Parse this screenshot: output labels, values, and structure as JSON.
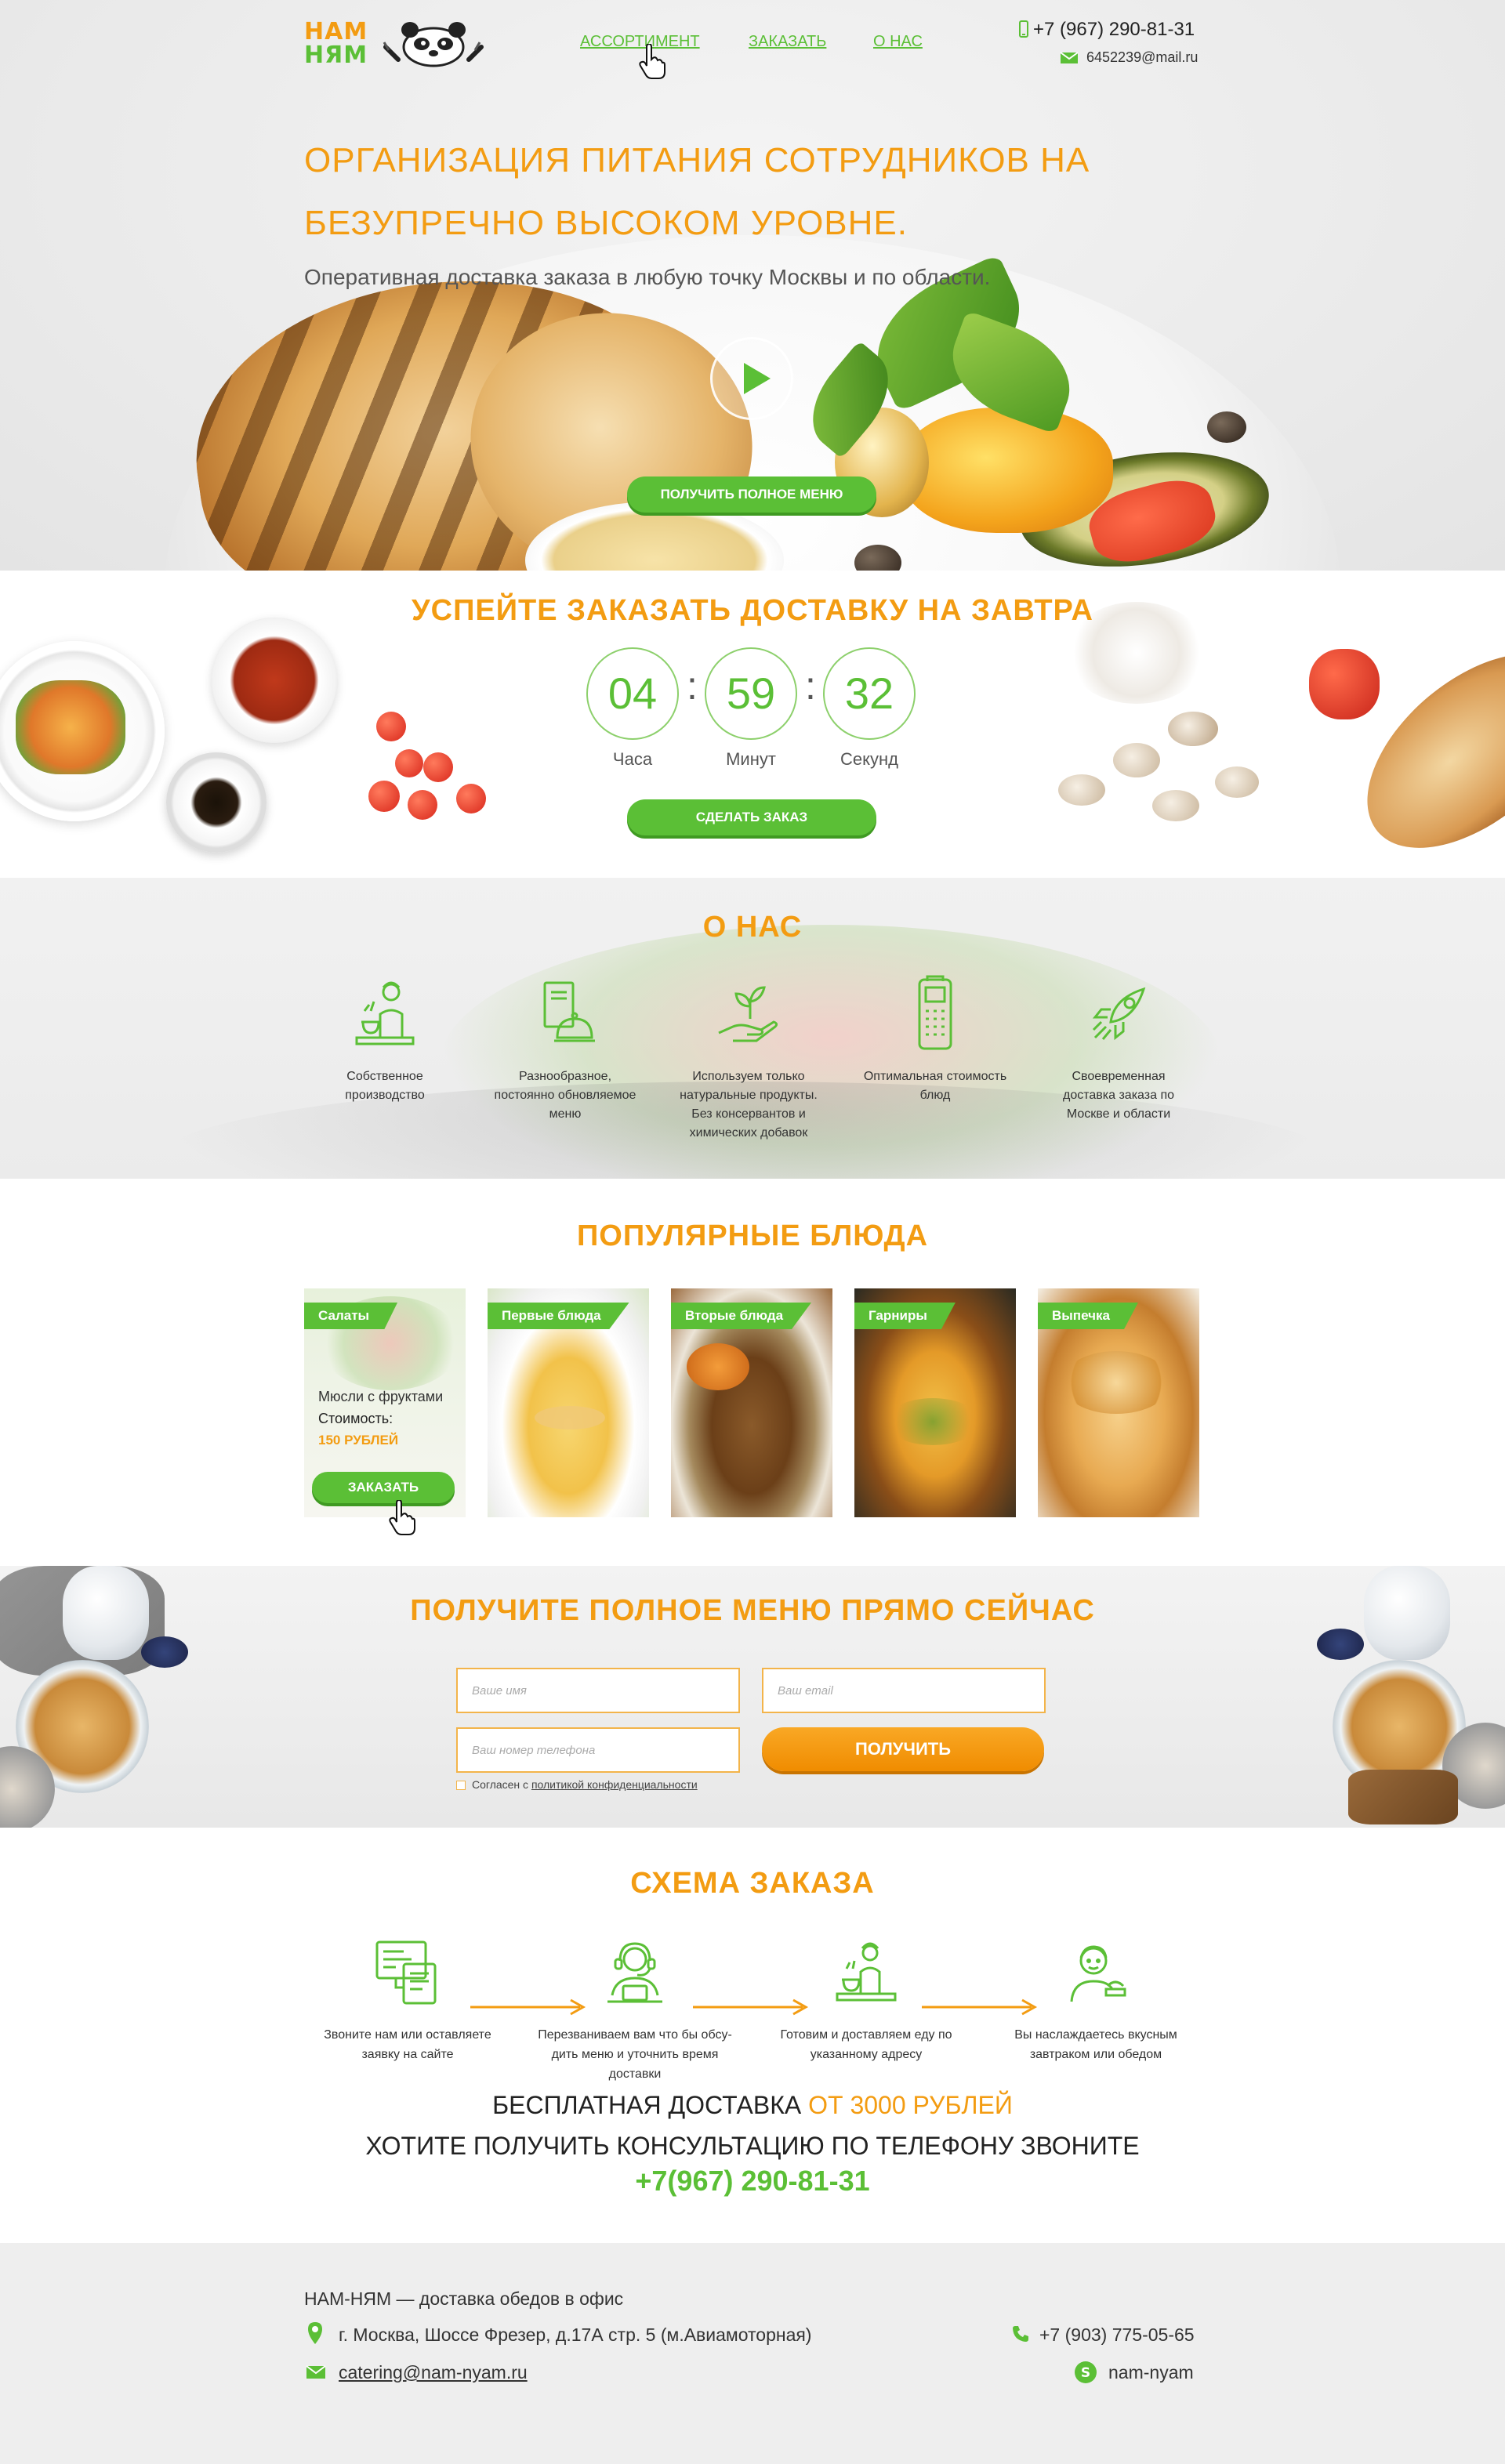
{
  "header": {
    "logo_top": "НАМ",
    "logo_bottom": "НЯМ",
    "nav": [
      {
        "label": "АССОРТИМЕНТ"
      },
      {
        "label": "ЗАКАЗАТЬ"
      },
      {
        "label": "О НАС"
      }
    ],
    "phone": "+7 (967) 290-81-31",
    "email": "6452239@mail.ru"
  },
  "hero": {
    "title_line1": "ОРГАНИЗАЦИЯ ПИТАНИЯ СОТРУДНИКОВ НА",
    "title_line2": "БЕЗУПРЕЧНО ВЫСОКОМ УРОВНЕ.",
    "subtitle": "Оперативная доставка заказа в любую точку Москвы и по области.",
    "cta": "ПОЛУЧИТЬ ПОЛНОЕ МЕНЮ"
  },
  "countdown": {
    "title": "УСПЕЙТЕ ЗАКАЗАТЬ ДОСТАВКУ НА ЗАВТРА",
    "hours": "04",
    "minutes": "59",
    "seconds": "32",
    "hours_label": "Часа",
    "minutes_label": "Минут",
    "seconds_label": "Секунд",
    "cta": "СДЕЛАТЬ ЗАКАЗ"
  },
  "about": {
    "title": "О НАС",
    "features": [
      {
        "text": "Собственное производство",
        "icon": "chef-icon"
      },
      {
        "text": "Разнообразное, постоянно обновляемое меню",
        "icon": "menu-cloche-icon"
      },
      {
        "text": "Используем только натуральные продукты. Без консервантов и химических добавок",
        "icon": "sprout-hand-icon"
      },
      {
        "text": "Оптимальная стоимость блюд",
        "icon": "payment-terminal-icon"
      },
      {
        "text": "Своевременная доставка заказа по Москве и области",
        "icon": "rocket-icon"
      }
    ]
  },
  "popular": {
    "title": "ПОПУЛЯРНЫЕ БЛЮДА",
    "dishes": [
      {
        "category": "Салаты",
        "name": "Мюсли с фруктами",
        "price_label": "Стоимость:",
        "price": "150 РУБЛЕЙ",
        "cta": "ЗАКАЗАТЬ"
      },
      {
        "category": "Первые блюда"
      },
      {
        "category": "Вторые блюда"
      },
      {
        "category": "Гарниры"
      },
      {
        "category": "Выпечка"
      }
    ]
  },
  "getmenu": {
    "title": "ПОЛУЧИТЕ ПОЛНОЕ МЕНЮ ПРЯМО СЕЙЧАС",
    "name_placeholder": "Ваше имя",
    "email_placeholder": "Ваш email",
    "phone_placeholder": "Ваш номер телефона",
    "submit": "ПОЛУЧИТЬ",
    "consent_prefix": "Согласен с ",
    "consent_link": "политикой конфиденциальности"
  },
  "scheme": {
    "title": "СХЕМА ЗАКАЗА",
    "steps": [
      {
        "text": "Звоните нам или оставляете заявку на сайте",
        "icon": "form-icon"
      },
      {
        "text": "Перезваниваем вам что бы обсу- дить меню и уточнить время доставки",
        "icon": "operator-icon"
      },
      {
        "text": "Готовим и доставляем еду по указанному адресу",
        "icon": "chef-icon"
      },
      {
        "text": "Вы наслаждаетесь вкусным завтраком или обедом",
        "icon": "eating-person-icon"
      }
    ],
    "free_delivery": "БЕСПЛАТНАЯ ДОСТАВКА",
    "free_delivery_amount": "ОТ 3000 РУБЛЕЙ",
    "consult": "ХОТИТЕ ПОЛУЧИТЬ КОНСУЛЬТАЦИЮ ПО ТЕЛЕФОНУ ЗВОНИТЕ",
    "consult_phone": "+7(967) 290-81-31"
  },
  "footer": {
    "tagline": "НАМ-НЯМ — доставка обедов в офис",
    "address": "г. Москва, Шоссе Фрезер, д.17А стр. 5 (м.Авиамоторная)",
    "email": "catering@nam-nyam.ru",
    "phone": "+7 (903) 775-05-65",
    "skype": "nam-nyam"
  },
  "colors": {
    "accent_orange": "#f39c12",
    "accent_green": "#5bbf36"
  }
}
